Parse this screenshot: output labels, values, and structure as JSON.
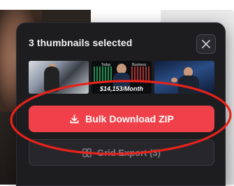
{
  "popup": {
    "title": "3 thumbnails selected",
    "close_icon": "close-icon"
  },
  "thumbnails": [
    {
      "name": "thumbnail-1"
    },
    {
      "name": "thumbnail-2",
      "tag_left": "Today",
      "tag_right": "Business",
      "caption": "$14,153/Month"
    },
    {
      "name": "thumbnail-3"
    }
  ],
  "actions": {
    "primary_label": "Bulk Download ZIP",
    "primary_icon": "download-icon",
    "secondary_label": "Grid Export (3)",
    "secondary_icon": "grid-icon"
  },
  "colors": {
    "accent": "#f0404a",
    "annotation": "#e8221b",
    "panel": "#1d1d20"
  }
}
